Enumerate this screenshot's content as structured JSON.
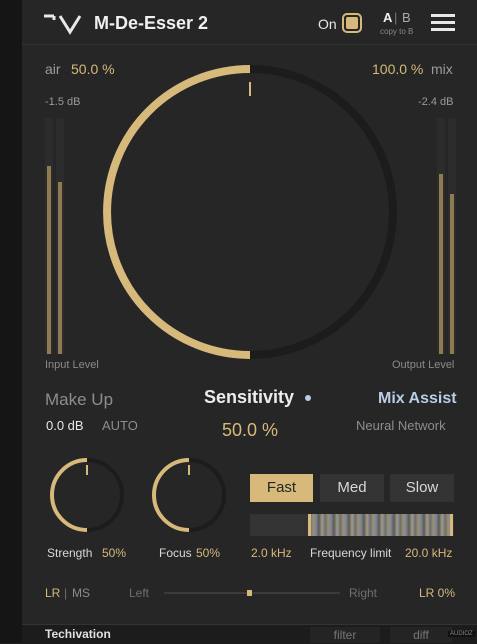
{
  "header": {
    "logo_text": "⌐\\/",
    "title": "M-De-Esser 2",
    "on_label": "On",
    "ab_a": "A",
    "ab_sep": "|",
    "ab_b": "B",
    "ab_sub": "copy to B"
  },
  "params": {
    "air_label": "air",
    "air_value": "50.0 %",
    "mix_value": "100.0 %",
    "mix_label": "mix",
    "input_db": "-1.5 dB",
    "output_db": "-2.4 dB",
    "input_level_label": "Input Level",
    "output_level_label": "Output Level",
    "sensitivity_fraction": 0.5
  },
  "mid": {
    "makeup_label": "Make Up",
    "makeup_value": "0.0 dB",
    "auto_label": "AUTO",
    "sensitivity_label": "Sensitivity",
    "sensitivity_value": "50.0 %",
    "mix_assist_label": "Mix Assist",
    "neural_label": "Neural Network"
  },
  "knobs": {
    "strength_label": "Strength",
    "strength_value": "50%",
    "focus_label": "Focus",
    "focus_value": "50%"
  },
  "speed": {
    "fast": "Fast",
    "med": "Med",
    "slow": "Slow",
    "selected": "Fast"
  },
  "freq": {
    "low": "2.0 kHz",
    "label": "Frequency limit",
    "high": "20.0 kHz"
  },
  "stereo": {
    "lr": "LR",
    "sep": "|",
    "ms": "MS",
    "left": "Left",
    "right": "Right",
    "balance": "LR 0%"
  },
  "footer": {
    "brand": "Techivation",
    "filter": "filter",
    "diff": "diff",
    "watermark": "AUDIOZ"
  },
  "colors": {
    "accent": "#d6b97b",
    "assist": "#b9cde6",
    "background": "#262626"
  }
}
